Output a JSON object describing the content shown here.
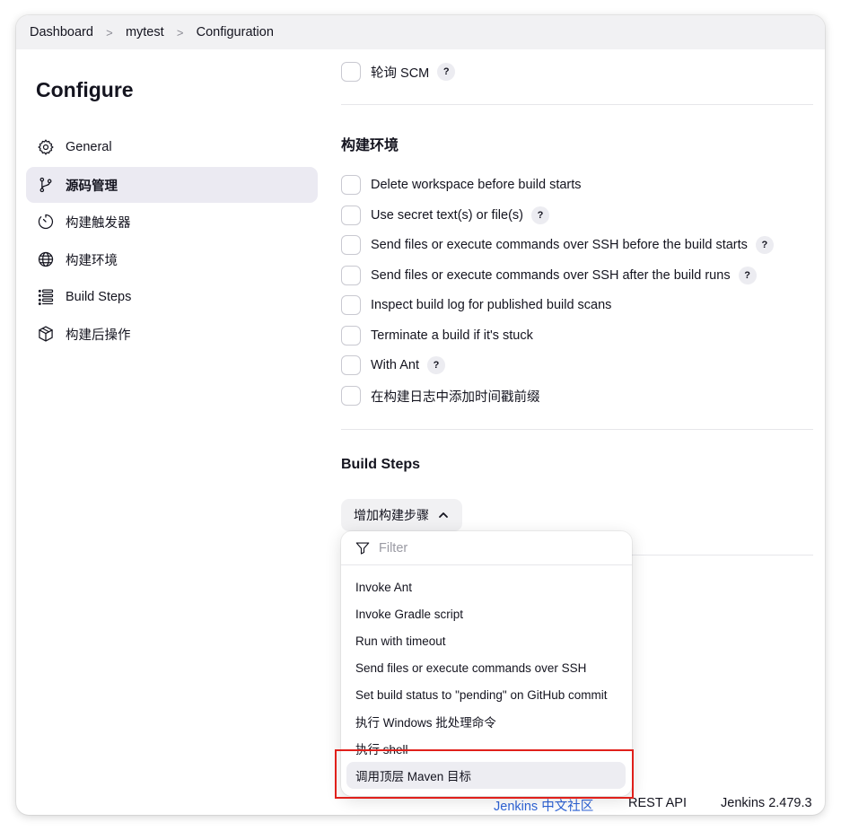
{
  "breadcrumb": {
    "items": [
      "Dashboard",
      "mytest",
      "Configuration"
    ]
  },
  "sidebar": {
    "title": "Configure",
    "items": [
      {
        "label": "General",
        "icon": "gear-icon"
      },
      {
        "label": "源码管理",
        "icon": "branch-icon",
        "active": true
      },
      {
        "label": "构建触发器",
        "icon": "timer-icon"
      },
      {
        "label": "构建环境",
        "icon": "globe-icon"
      },
      {
        "label": "Build Steps",
        "icon": "list-icon"
      },
      {
        "label": "构建后操作",
        "icon": "package-icon"
      }
    ]
  },
  "top_option": {
    "label": "轮询 SCM",
    "help": "?"
  },
  "build_env": {
    "heading": "构建环境",
    "options": [
      {
        "label": "Delete workspace before build starts",
        "help": ""
      },
      {
        "label": "Use secret text(s) or file(s)",
        "help": "?"
      },
      {
        "label": "Send files or execute commands over SSH before the build starts",
        "help": "?"
      },
      {
        "label": "Send files or execute commands over SSH after the build runs",
        "help": "?"
      },
      {
        "label": "Inspect build log for published build scans",
        "help": ""
      },
      {
        "label": "Terminate a build if it's stuck",
        "help": ""
      },
      {
        "label": "With Ant",
        "help": "?"
      },
      {
        "label": "在构建日志中添加时间戳前缀",
        "help": ""
      }
    ]
  },
  "build_steps": {
    "heading": "Build Steps",
    "add_button": "增加构建步骤",
    "dropdown": {
      "filter_placeholder": "Filter",
      "items": [
        "Invoke Ant",
        "Invoke Gradle script",
        "Run with timeout",
        "Send files or execute commands over SSH",
        "Set build status to \"pending\" on GitHub commit",
        "执行 Windows 批处理命令",
        "执行 shell",
        "调用顶层 Maven 目标"
      ],
      "highlighted_index": 7
    }
  },
  "footer": {
    "community": "Jenkins 中文社区",
    "rest_api": "REST API",
    "version": "Jenkins 2.479.3"
  },
  "colors": {
    "active_bg": "#ebeaf2",
    "highlight_box": "#e0201b",
    "text": "#14141f"
  }
}
